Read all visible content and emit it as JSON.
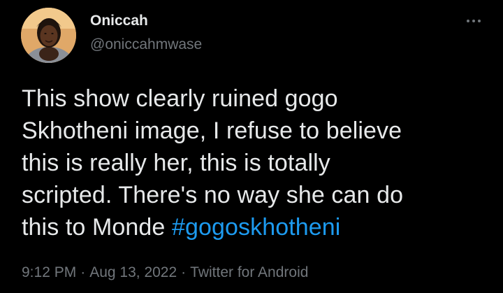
{
  "author": {
    "display_name": "Oniccah",
    "handle": "@oniccahmwase"
  },
  "tweet": {
    "lines": [
      "This show clearly ruined gogo",
      "Skhotheni image, I refuse to believe",
      "this is really her, this is totally",
      "scripted. There's no way she can do",
      "this to Monde "
    ],
    "hashtag": "#gogoskhotheni"
  },
  "meta": {
    "time": "9:12 PM",
    "date": "Aug 13, 2022",
    "source": "Twitter for Android",
    "separator": "·"
  },
  "icons": {
    "more": "more-options-icon",
    "avatar": "profile-avatar"
  },
  "colors": {
    "background": "#000000",
    "text": "#e7e9ea",
    "secondary": "#71767b",
    "link": "#1d9bf0"
  }
}
